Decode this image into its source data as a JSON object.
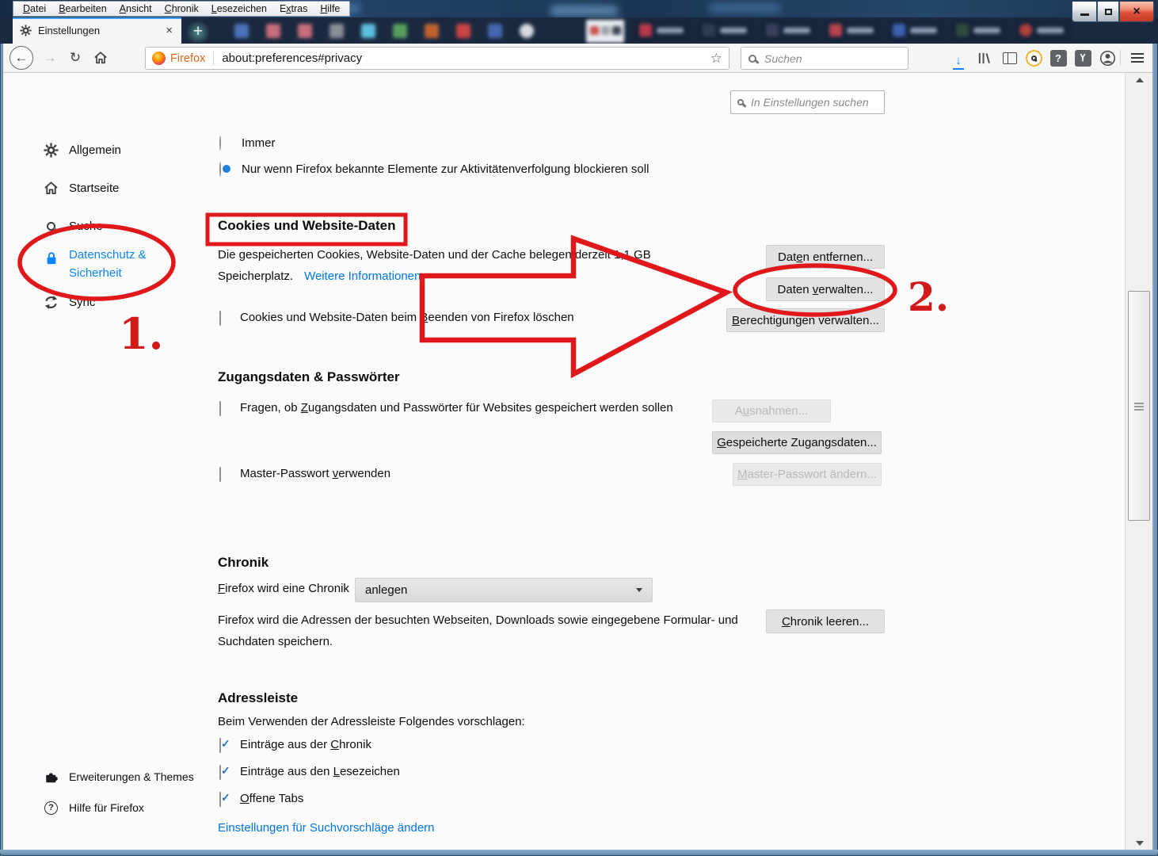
{
  "colors": {
    "accent_blue": "#0a84ff",
    "link_blue": "#0074e8",
    "annotation_red": "#e0181c",
    "titlebar_navy": "#1b2940"
  },
  "titlebar": {
    "menu_items": [
      {
        "pre": "",
        "key": "D",
        "post": "atei"
      },
      {
        "pre": "",
        "key": "B",
        "post": "earbeiten"
      },
      {
        "pre": "",
        "key": "A",
        "post": "nsicht"
      },
      {
        "pre": "",
        "key": "C",
        "post": "hronik"
      },
      {
        "pre": "",
        "key": "L",
        "post": "esezeichen"
      },
      {
        "pre": "E",
        "key": "x",
        "post": "tras"
      },
      {
        "pre": "",
        "key": "H",
        "post": "ilfe"
      }
    ]
  },
  "tabbar": {
    "active_tab_title": "Einstellungen",
    "close_glyph": "×",
    "new_tab_glyph": "+"
  },
  "navbar": {
    "brand": "Firefox",
    "url": "about:preferences#privacy",
    "search_placeholder": "Suchen"
  },
  "page": {
    "search_placeholder": "In Einstellungen suchen",
    "sidebar": {
      "items": [
        {
          "label": "Allgemein"
        },
        {
          "label": "Startseite"
        },
        {
          "label": "Suche"
        },
        {
          "line1": "Datenschutz &",
          "line2": "Sicherheit"
        },
        {
          "label": "Sync"
        }
      ],
      "footer": [
        {
          "label": "Erweiterungen & Themes"
        },
        {
          "label": "Hilfe für Firefox"
        }
      ]
    },
    "tracking": {
      "radio_always": "Immer",
      "radio_known": "Nur wenn Firefox bekannte Elemente zur Aktivitätenverfolgung blockieren soll"
    },
    "cookies": {
      "heading": "Cookies und Website-Daten",
      "desc_line1": "Die gespeicherten Cookies, Website-Daten und der Cache belegen derzeit 1,1 GB",
      "desc_line2": "Speicherplatz.",
      "link": "Weitere Informationen",
      "clear_checkbox": {
        "pre": "Cookies und Website-Daten beim ",
        "key": "B",
        "post": "eenden von Firefox löschen"
      },
      "btn_remove": {
        "pre": "Dat",
        "key": "e",
        "post": "n entfernen..."
      },
      "btn_manage": {
        "pre": "Daten ",
        "key": "v",
        "post": "erwalten..."
      },
      "btn_permissions": {
        "pre": "",
        "key": "B",
        "post": "erechtigungen verwalten..."
      }
    },
    "logins": {
      "heading": "Zugangsdaten & Passwörter",
      "ask_checkbox": {
        "pre": "Fragen, ob ",
        "key": "Z",
        "post": "ugangsdaten und Passwörter für Websites gespeichert werden sollen"
      },
      "btn_exceptions": {
        "pre": "A",
        "key": "u",
        "post": "snahmen..."
      },
      "btn_saved": {
        "pre": "",
        "key": "G",
        "post": "espeicherte Zugangsdaten..."
      },
      "master_checkbox": {
        "pre": "Master-Passwort ",
        "key": "v",
        "post": "erwenden"
      },
      "btn_master": {
        "pre": "",
        "key": "M",
        "post": "aster-Passwort ändern..."
      }
    },
    "history": {
      "heading": "Chronik",
      "select_label": {
        "pre": "",
        "key": "F",
        "post": "irefox wird eine Chronik"
      },
      "select_value": "anlegen",
      "desc_line1": "Firefox wird die Adressen der besuchten Webseiten, Downloads sowie eingegebene Formular- und",
      "desc_line2": "Suchdaten speichern.",
      "btn_clear": {
        "pre": "",
        "key": "C",
        "post": "hronik leeren..."
      }
    },
    "addressbar": {
      "heading": "Adressleiste",
      "intro": "Beim Verwenden der Adressleiste Folgendes vorschlagen:",
      "cb_history": {
        "pre": "Einträge aus der ",
        "key": "C",
        "post": "hronik"
      },
      "cb_bookmarks": {
        "pre": "Einträge aus den ",
        "key": "L",
        "post": "esezeichen"
      },
      "cb_tabs": {
        "pre": "",
        "key": "O",
        "post": "ffene Tabs"
      },
      "link": "Einstellungen für Suchvorschläge ändern"
    }
  },
  "annotations": {
    "step1": "1.",
    "step2": "2."
  }
}
